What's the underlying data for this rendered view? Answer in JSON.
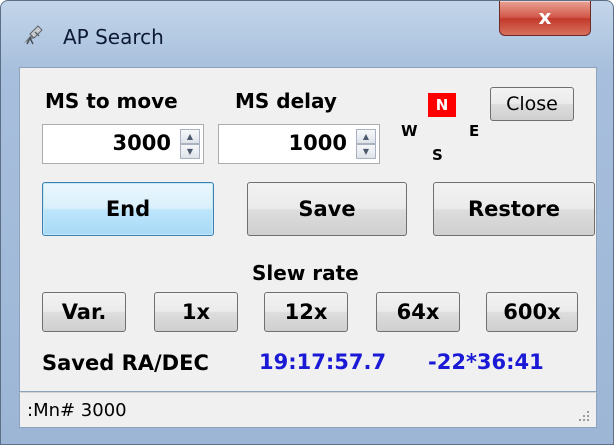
{
  "window": {
    "title": "AP Search",
    "close_glyph": "x"
  },
  "controls": {
    "ms_to_move": {
      "label": "MS to move",
      "value": "3000"
    },
    "ms_delay": {
      "label": "MS delay",
      "value": "1000"
    },
    "close_label": "Close",
    "compass": {
      "n": "N",
      "w": "W",
      "e": "E",
      "s": "S"
    }
  },
  "actions": {
    "end": "End",
    "save": "Save",
    "restore": "Restore"
  },
  "slew": {
    "label": "Slew rate",
    "buttons": [
      "Var.",
      "1x",
      "12x",
      "64x",
      "600x"
    ]
  },
  "saved": {
    "label": "Saved RA/DEC",
    "ra": "19:17:57.7",
    "dec": "-22*36:41"
  },
  "status": {
    "text": ":Mn# 3000"
  },
  "colors": {
    "north_badge": "#ff0000",
    "coords": "#1a1ad6",
    "focus_button": "#bee6fd"
  },
  "icons": {
    "app": "telescope-icon",
    "close": "close-icon",
    "spin_up": "spin-up-icon",
    "spin_down": "spin-down-icon",
    "grip": "resize-grip-icon"
  }
}
